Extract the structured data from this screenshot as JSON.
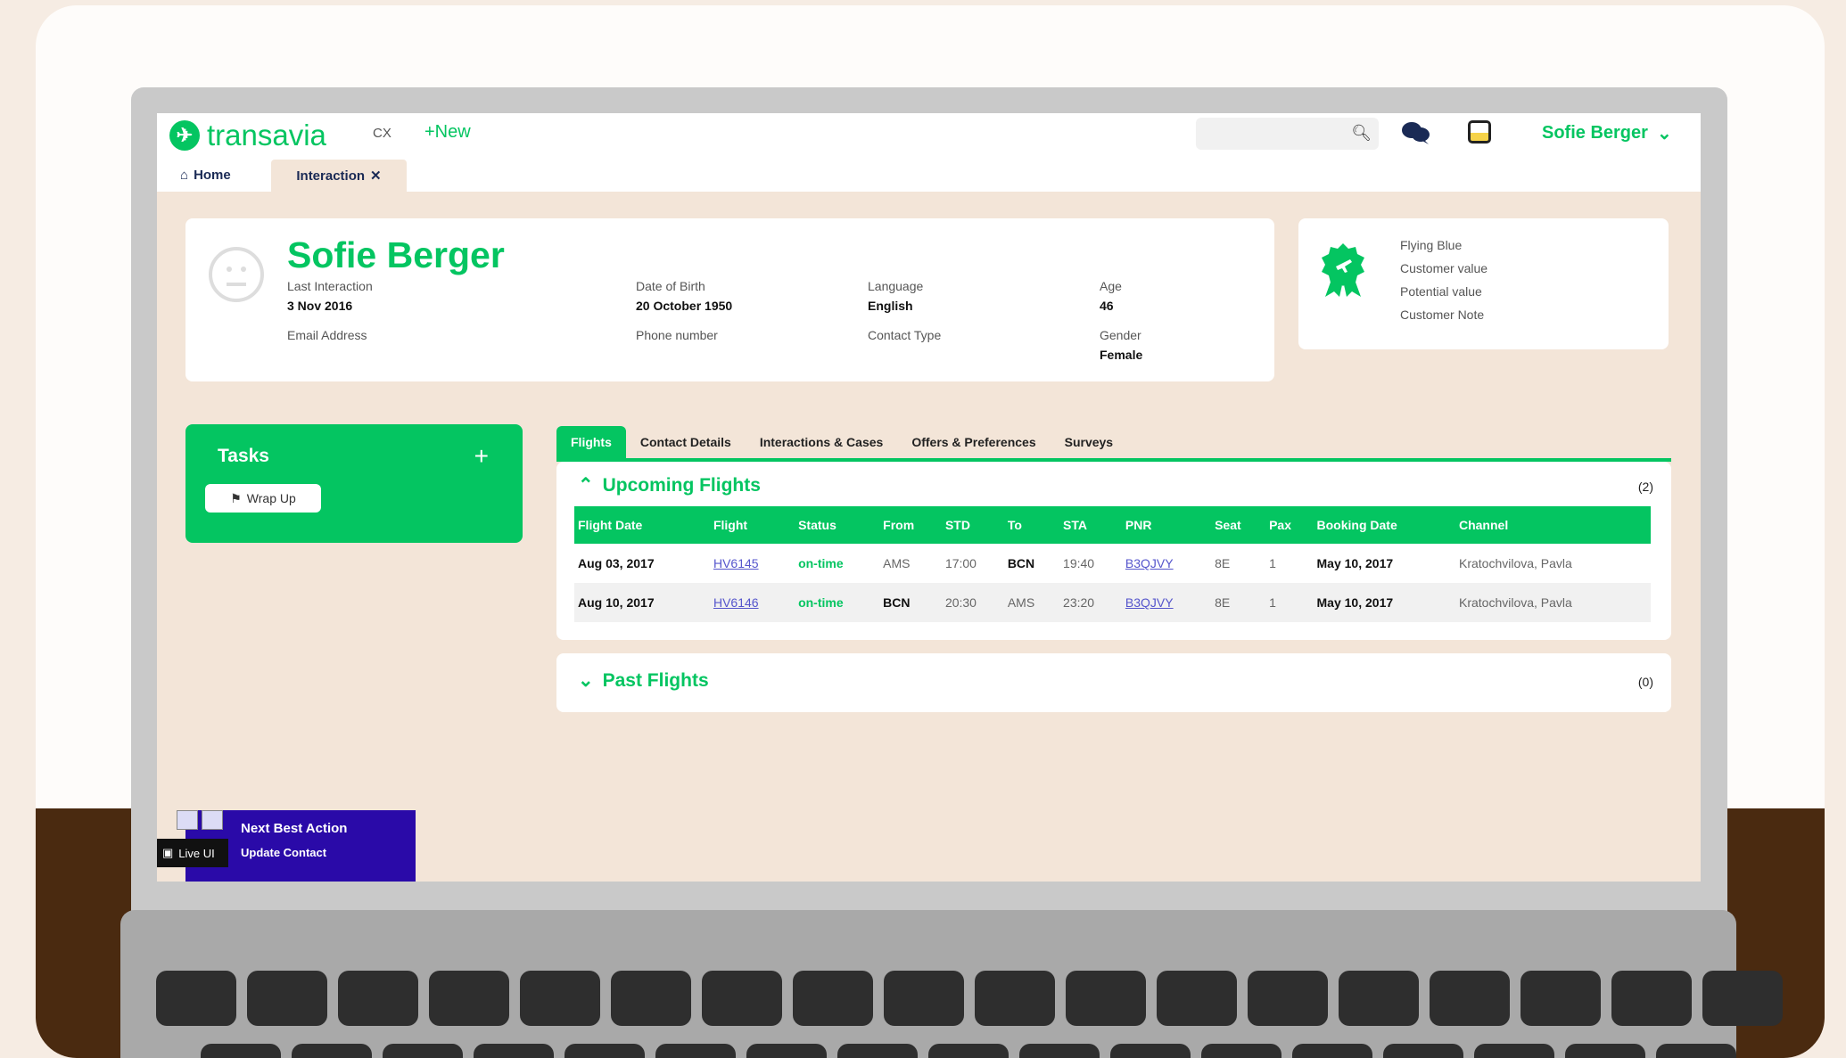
{
  "app": {
    "brand": "transavia",
    "module": "CX",
    "new_label": "+New",
    "user_name": "Sofie Berger",
    "search_placeholder": ""
  },
  "tabs": {
    "home": "Home",
    "interaction": "Interaction"
  },
  "profile": {
    "name": "Sofie Berger",
    "last_interaction_label": "Last Interaction",
    "last_interaction": "3 Nov 2016",
    "email_label": "Email Address",
    "dob_label": "Date of Birth",
    "dob": "20 October 1950",
    "phone_label": "Phone number",
    "language_label": "Language",
    "language": "English",
    "contact_type_label": "Contact Type",
    "age_label": "Age",
    "age": "46",
    "gender_label": "Gender",
    "gender": "Female"
  },
  "loyalty": {
    "lines": [
      "Flying Blue",
      "Customer value",
      "Potential value",
      "Customer Note"
    ]
  },
  "tasks": {
    "title": "Tasks",
    "plus": "+",
    "wrap_up": "Wrap Up"
  },
  "main_tabs": [
    "Flights",
    "Contact Details",
    "Interactions & Cases",
    "Offers & Preferences",
    "Surveys"
  ],
  "upcoming": {
    "title": "Upcoming Flights",
    "count": "(2)",
    "columns": [
      "Flight Date",
      "Flight",
      "Status",
      "From",
      "STD",
      "To",
      "STA",
      "PNR",
      "Seat",
      "Pax",
      "Booking Date",
      "Channel"
    ],
    "rows": [
      [
        "Aug 03, 2017",
        "HV6145",
        "on-time",
        "AMS",
        "17:00",
        "BCN",
        "19:40",
        "B3QJVY",
        "8E",
        "1",
        "May 10, 2017",
        "Kratochvilova, Pavla"
      ],
      [
        "Aug 10, 2017",
        "HV6146",
        "on-time",
        "BCN",
        "20:30",
        "AMS",
        "23:20",
        "B3QJVY",
        "8E",
        "1",
        "May 10, 2017",
        "Kratochvilova, Pavla"
      ]
    ]
  },
  "past": {
    "title": "Past Flights",
    "count": "(0)"
  },
  "nba": {
    "title": "Next Best Action",
    "action": "Update Contact",
    "live_ui": "Live UI"
  },
  "colors": {
    "brand_green": "#04c561",
    "nba_purple": "#2a0aa8"
  }
}
